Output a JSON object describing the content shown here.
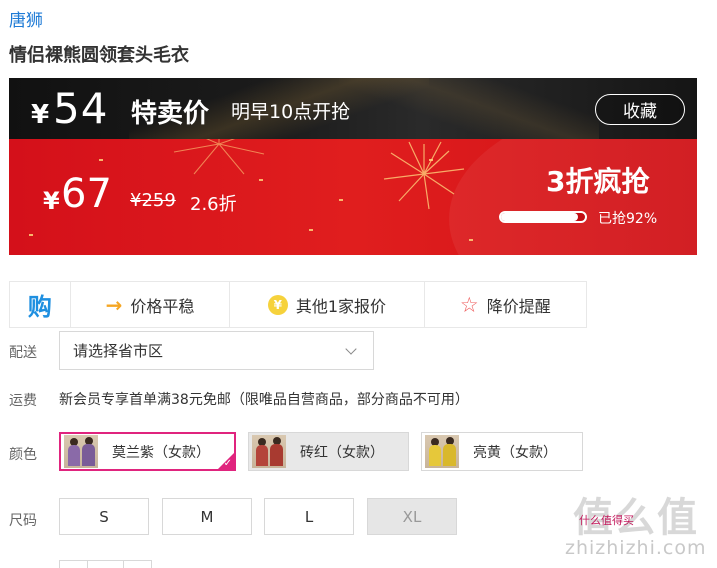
{
  "brand": "唐狮",
  "product_title": "情侣裸熊圆领套头毛衣",
  "flash_sale": {
    "currency": "¥",
    "price": "54",
    "label": "特卖价",
    "start_time": "明早10点开抢",
    "favorite_button": "收藏"
  },
  "current_sale": {
    "currency": "¥",
    "price": "67",
    "list_price": "¥259",
    "discount": "2.6折",
    "promo_text": "3折疯抢",
    "sold_percent": 92,
    "sold_text": "已抢92%"
  },
  "features": [
    {
      "icon": "gou-logo-icon",
      "logo_text": "购"
    },
    {
      "icon": "arrow-right-icon",
      "label": "价格平稳"
    },
    {
      "icon": "yen-coin-icon",
      "label": "其他1家报价"
    },
    {
      "icon": "star-icon",
      "label": "降价提醒"
    }
  ],
  "delivery": {
    "label": "配送",
    "placeholder": "请选择省市区"
  },
  "shipping": {
    "label": "运费",
    "text": "新会员专享首单满38元免邮（限唯品自营商品，部分商品不可用）"
  },
  "color": {
    "label": "颜色",
    "options": [
      {
        "name": "莫兰紫（女款）",
        "selected": true,
        "available": true
      },
      {
        "name": "砖红（女款）",
        "selected": false,
        "available": true
      },
      {
        "name": "亮黄（女款）",
        "selected": false,
        "available": true
      }
    ]
  },
  "size": {
    "label": "尺码",
    "options": [
      {
        "name": "S",
        "available": true
      },
      {
        "name": "M",
        "available": true
      },
      {
        "name": "L",
        "available": true
      },
      {
        "name": "XL",
        "available": false
      }
    ]
  },
  "watermark": {
    "big": "值么值",
    "pink": "什么值得买",
    "small": "zhizhizhi.com"
  },
  "colors": {
    "brand_blue": "#1f7bd6",
    "sale_red": "#d4101a",
    "selected_pink": "#e0247e"
  }
}
